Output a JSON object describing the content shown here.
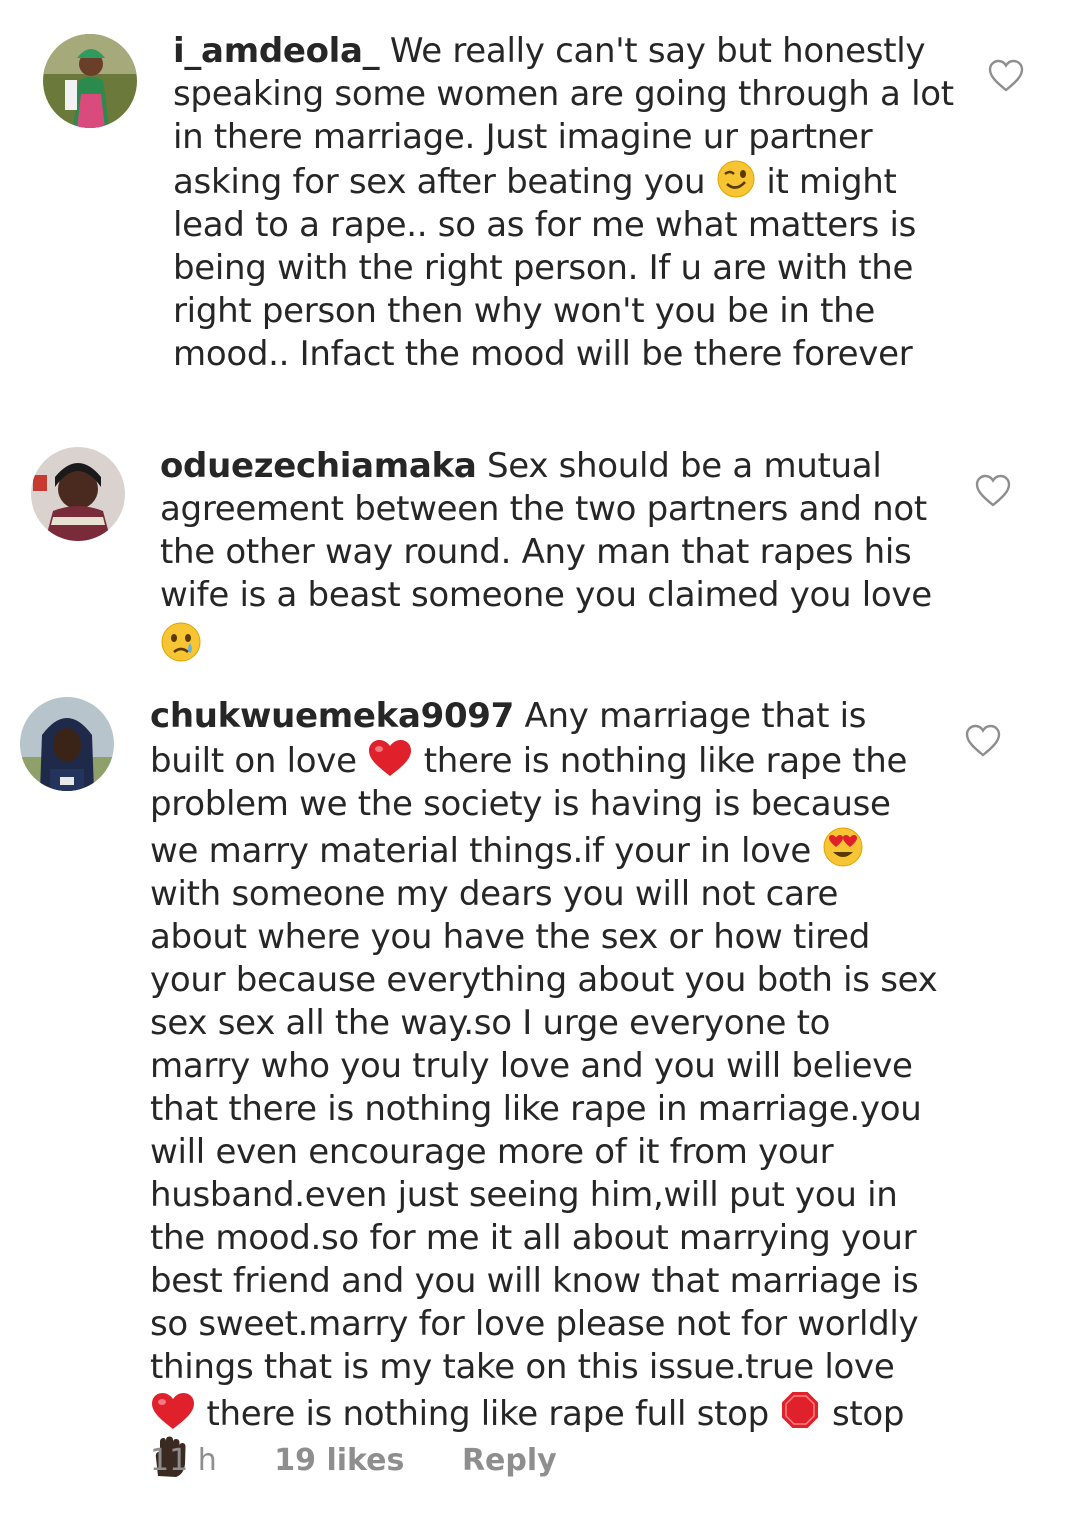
{
  "comments": [
    {
      "username": "i_amdeola_",
      "parts": [
        "We really can't say but honestly speaking some women are going through a lot in there marriage. Just imagine ur partner asking for sex after beating you",
        "it might lead to a rape.. so as for me what matters is being with the right person. If u are with the right person then why won't you be in the mood.. Infact the mood will be there forever"
      ],
      "emoji": "winking-face"
    },
    {
      "username": "oduezechiamaka",
      "parts": [
        "Sex should be a mutual agreement between the two partners and not the other way round. Any man that rapes his wife is a beast someone you claimed you love"
      ],
      "emoji": "crying-face"
    },
    {
      "username": "chukwuemeka9097",
      "parts": [
        "Any marriage that is built on love",
        "there is nothing like rape the problem we the society is having is because we marry material things.if your in love",
        "with someone my dears you will not care about where you have the sex or how tired your because everything about you both is sex sex sex all the way.so I urge everyone to marry who you truly love and you will believe that there is nothing like rape in marriage.you will even encourage more of it from your husband.even just seeing him,will put you in the mood.so for me it all about marrying your best friend and you will know that marriage is so sweet.marry for love please not for worldly things that is my take on this issue.true love",
        "there is nothing like rape full stop",
        "stop"
      ],
      "time": "11 h",
      "likes": "19 likes",
      "reply": "Reply"
    }
  ],
  "icons": [
    "heart-outline-icon",
    "red-heart-emoji",
    "heart-eyes-emoji",
    "stop-sign-emoji",
    "raised-hand-emoji"
  ],
  "colors": {
    "text": "#262626",
    "meta": "#8e8e8e",
    "heart_outline": "#8e8e8e"
  }
}
